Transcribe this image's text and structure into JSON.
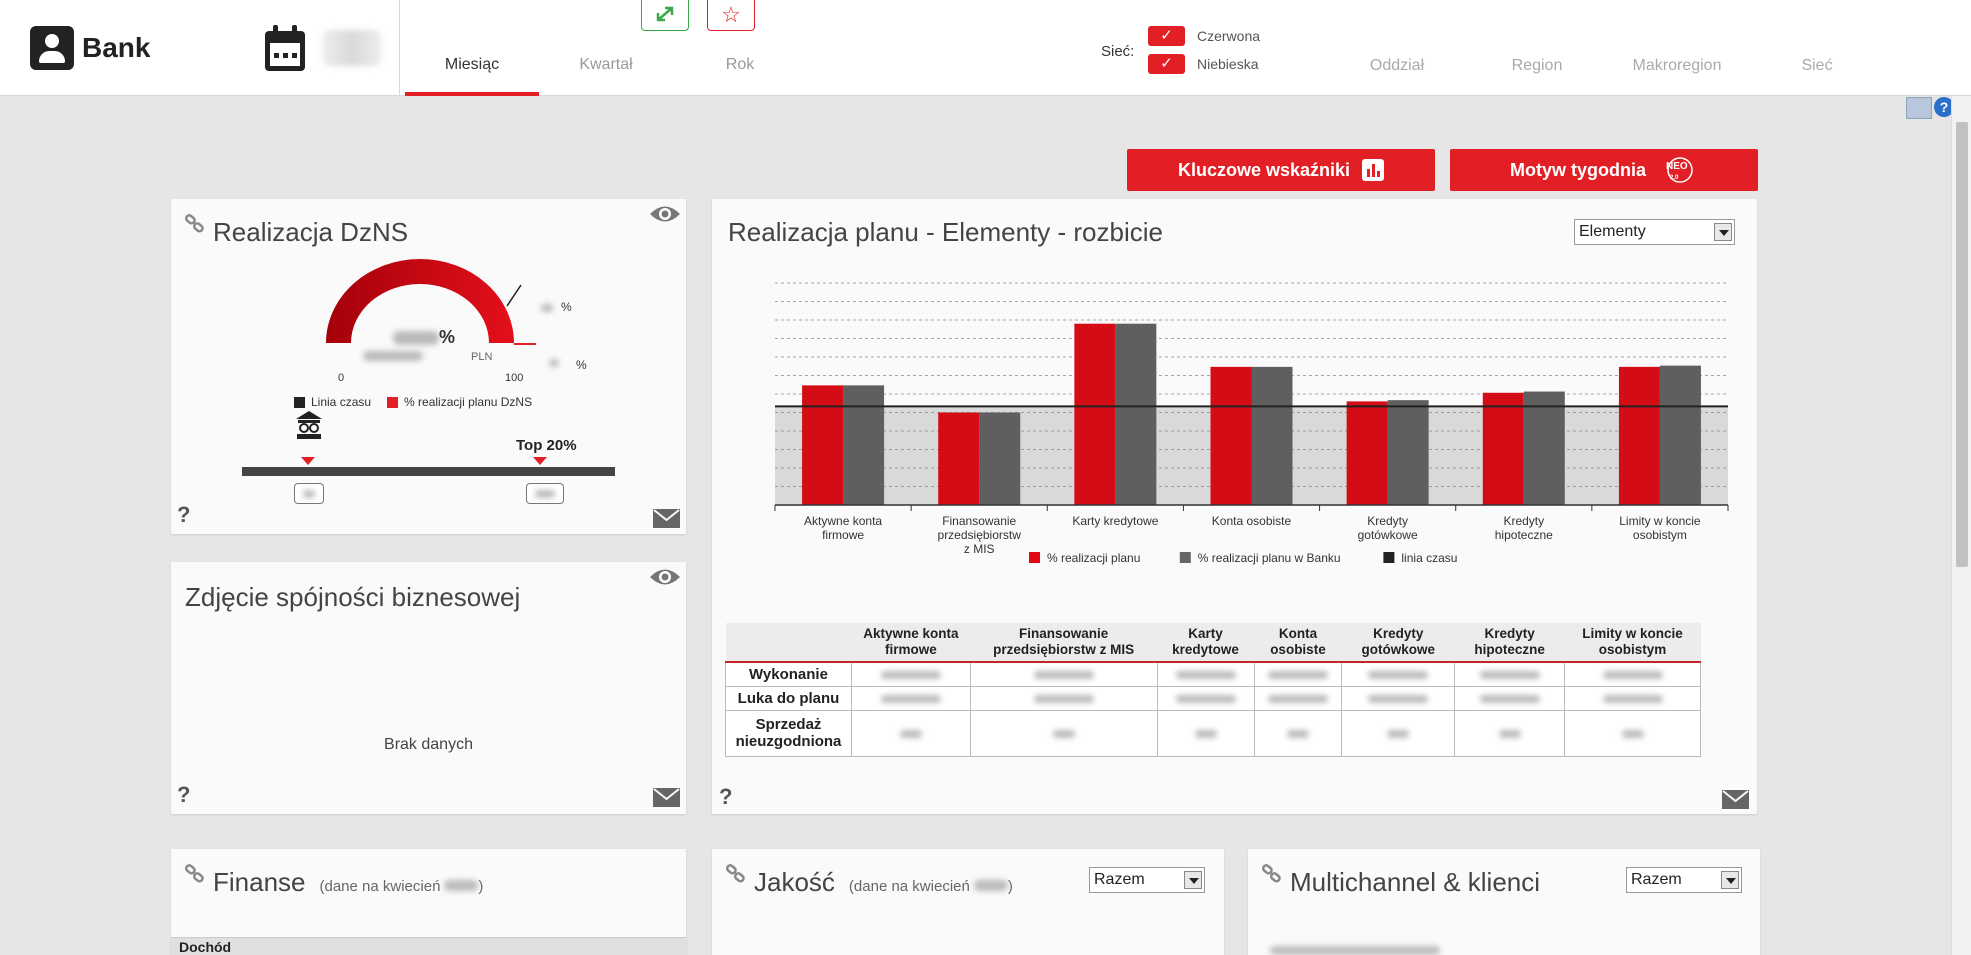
{
  "header": {
    "brand": "Bank",
    "period_tabs": [
      "Miesiąc",
      "Kwartał",
      "Rok"
    ],
    "network_label": "Sieć:",
    "checkboxes": [
      {
        "label": "Czerwona",
        "checked": true
      },
      {
        "label": "Niebieska",
        "checked": true
      }
    ],
    "region_tabs": [
      "Oddział",
      "Region",
      "Makroregion",
      "Sieć"
    ]
  },
  "buttons": {
    "key_indicators": "Kluczowe wskaźniki",
    "week_motive": "Motyw tygodnia",
    "neo_badge": "NEO 2.0"
  },
  "dzns_card": {
    "title": "Realizacja DzNS",
    "gauge_value_suffix": "%",
    "gauge_unit": "PLN",
    "gauge_min": "0",
    "gauge_max": "100",
    "gauge_side_suffix_1": "%",
    "gauge_side_suffix_2": "%",
    "legend": [
      "Linia czasu",
      "% realizacji planu DzNS"
    ],
    "top_label": "Top 20%"
  },
  "coherence_card": {
    "title": "Zdjęcie spójności biznesowej",
    "empty_text": "Brak danych"
  },
  "plan_card": {
    "title": "Realizacja planu - Elementy - rozbicie",
    "select_value": "Elementy"
  },
  "chart_data": {
    "type": "bar",
    "categories": [
      [
        "Aktywne konta",
        "firmowe"
      ],
      [
        "Finansowanie",
        "przedsiębiorstw",
        "z MIS"
      ],
      [
        "Karty kredytowe"
      ],
      [
        "Konta osobiste"
      ],
      [
        "Kredyty",
        "gotówkowe"
      ],
      [
        "Kredyty",
        "hipoteczne"
      ],
      [
        "Limity w koncie",
        "osobistym"
      ]
    ],
    "series": [
      {
        "name": "% realizacji planu",
        "color": "#e30613",
        "values": [
          97,
          75,
          147,
          112,
          84,
          91,
          112
        ]
      },
      {
        "name": "% realizacji planu w Banku",
        "color": "#666666",
        "values": [
          97,
          75,
          147,
          112,
          85,
          92,
          113
        ]
      }
    ],
    "timeline": {
      "name": "linia czasu",
      "color": "#222222",
      "value": 80
    },
    "ylim": [
      0,
      180
    ],
    "grid": true,
    "legend_position": "bottom"
  },
  "plan_table": {
    "headers": [
      "Aktywne konta firmowe",
      "Finansowanie przedsiębiorstw z MIS",
      "Karty kredytowe",
      "Konta osobiste",
      "Kredyty gotówkowe",
      "Kredyty hipoteczne",
      "Limity w koncie osobistym"
    ],
    "rows": [
      "Wykonanie",
      "Luka do planu",
      "Sprzedaż nieuzgodniona"
    ]
  },
  "finance_card": {
    "title": "Finanse",
    "subtitle": "(dane na kwiecień",
    "subtitle_end": ")",
    "first_row": "Dochód"
  },
  "quality_card": {
    "title": "Jakość",
    "subtitle": "(dane na kwiecień",
    "subtitle_end": ")",
    "select_value": "Razem"
  },
  "multichannel_card": {
    "title": "Multichannel & klienci",
    "select_value": "Razem"
  }
}
